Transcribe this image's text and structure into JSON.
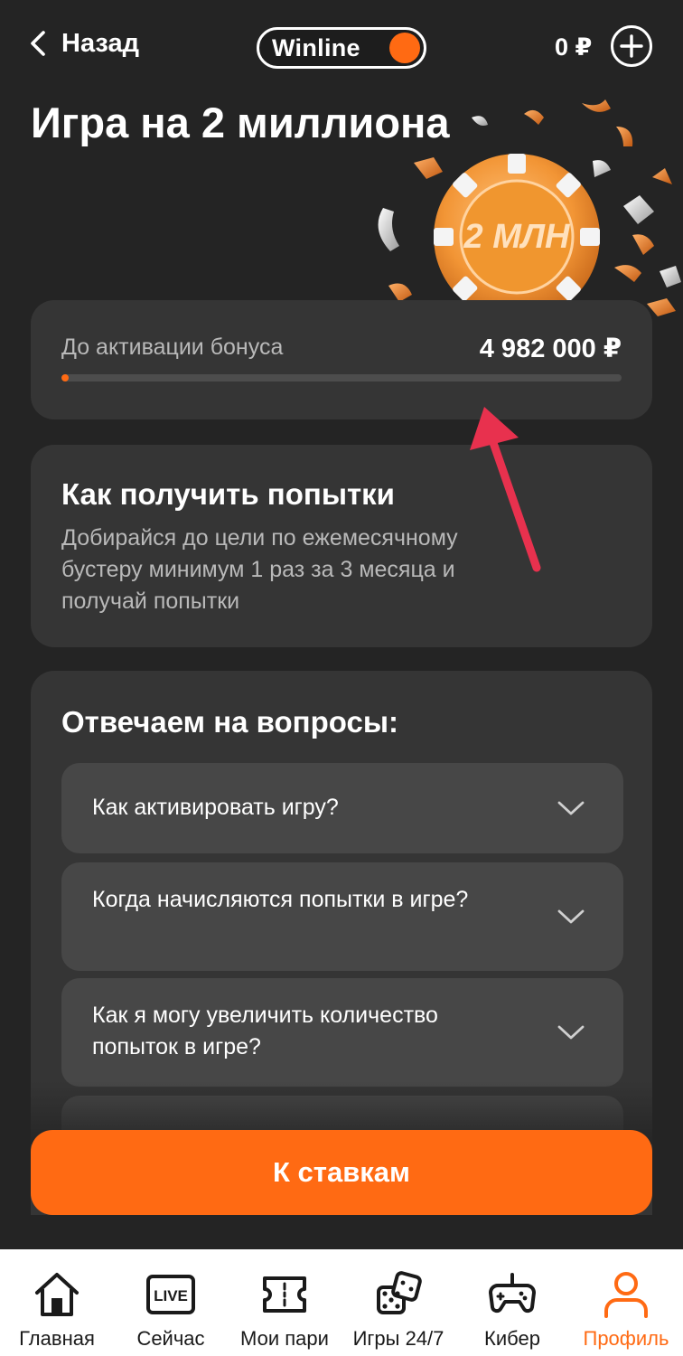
{
  "header": {
    "back_label": "Назад",
    "logo_text": "Winline",
    "balance": "0 ₽"
  },
  "page": {
    "title": "Игра на 2 миллиона",
    "chip_label": "2 МЛН"
  },
  "progress": {
    "label": "До активации бонуса",
    "amount": "4 982 000 ₽",
    "fraction": 0.009
  },
  "info": {
    "title": "Как получить попытки",
    "text": "Добирайся до цели по ежемесячному бустеру минимум 1 раз за 3 месяца и получай попытки"
  },
  "faq": {
    "title": "Отвечаем на вопросы:",
    "items": [
      {
        "question": "Как активировать игру?"
      },
      {
        "question": "Когда начисляются попытки в игре?"
      },
      {
        "question": "Как я могу увеличить количество попыток в игре?"
      }
    ]
  },
  "cta": {
    "label": "К ставкам"
  },
  "nav": {
    "items": [
      {
        "label": "Главная",
        "icon": "home-icon"
      },
      {
        "label": "Сейчас",
        "icon": "live-icon"
      },
      {
        "label": "Мои пари",
        "icon": "ticket-icon"
      },
      {
        "label": "Игры 24/7",
        "icon": "dice-icon"
      },
      {
        "label": "Кибер",
        "icon": "gamepad-icon"
      },
      {
        "label": "Профиль",
        "icon": "profile-icon"
      }
    ],
    "active_index": 5
  },
  "colors": {
    "accent": "#ff6a13",
    "background": "#242424",
    "card": "#353535",
    "faq_item": "#474747",
    "annotation_arrow": "#e8314e"
  }
}
